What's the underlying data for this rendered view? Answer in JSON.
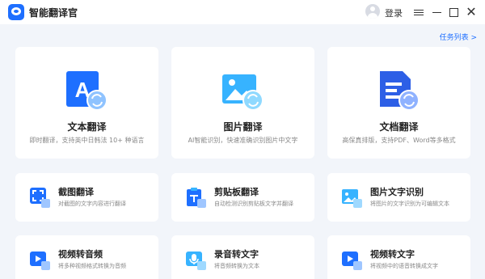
{
  "app": {
    "title": "智能翻译官"
  },
  "header": {
    "login_label": "登录",
    "task_list_label": "任务列表 >"
  },
  "big_cards": [
    {
      "title": "文本翻译",
      "desc": "即时翻译，支持英中日韩法 10+ 种语言",
      "icon": "text-translate-icon"
    },
    {
      "title": "图片翻译",
      "desc": "AI智能识别，快速准确识别图片中文字",
      "icon": "image-translate-icon"
    },
    {
      "title": "文档翻译",
      "desc": "高保真排版，支持PDF、Word等多格式",
      "icon": "document-translate-icon"
    }
  ],
  "small_cards": [
    {
      "title": "截图翻译",
      "desc": "对截图的文字内容进行翻译",
      "icon": "screenshot-translate-icon"
    },
    {
      "title": "剪贴板翻译",
      "desc": "自动检测识别剪贴板文字并翻译",
      "icon": "clipboard-translate-icon"
    },
    {
      "title": "图片文字识别",
      "desc": "将图片的文字识别为可编辑文本",
      "icon": "image-ocr-icon"
    },
    {
      "title": "视频转音频",
      "desc": "将多种视频格式转换为音频",
      "icon": "video-to-audio-icon"
    },
    {
      "title": "录音转文字",
      "desc": "将音频转换为文本",
      "icon": "audio-to-text-icon"
    },
    {
      "title": "视频转文字",
      "desc": "将视频中的语音转换成文字",
      "icon": "video-to-text-icon"
    }
  ],
  "colors": {
    "accent": "#1e6fff",
    "accent_light": "#37b3ff",
    "background": "#f2f5fa"
  }
}
